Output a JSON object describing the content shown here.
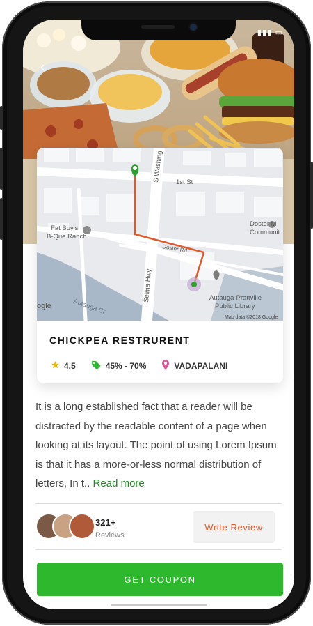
{
  "status": {
    "signal": "▮▮▮",
    "battery": "▭"
  },
  "map": {
    "street_washington": "S Washing",
    "street_1st": "1st St",
    "street_doster": "Doster Rd",
    "street_selma": "Selma Hwy",
    "street_autauga": "Autauga Cr",
    "poi_fatboys_1": "Fat Boy's",
    "poi_fatboys_2": "B-Que Ranch",
    "poi_doster_1": "Doster M",
    "poi_doster_2": "Communit",
    "poi_library_1": "Autauga-Prattville",
    "poi_library_2": "Public Library",
    "google_fragment": "ogle",
    "attribution": "Map data ©2018 Google"
  },
  "restaurant": {
    "name": "CHICKPEA RESTRURENT",
    "rating": "4.5",
    "discount": "45% - 70%",
    "location": "VADAPALANI"
  },
  "description": "It is a long established fact that a reader will be distracted by the readable content of a page when looking at its layout. The point of using Lorem Ipsum is that it has a more-or-less normal distribution of letters,  In t..",
  "read_more": "Read more",
  "reviews": {
    "count": "321+",
    "label": "Reviews",
    "write_label": "Write Review"
  },
  "coupon_label": "GET COUPON",
  "colors": {
    "accent_green": "#2eb82e",
    "link_green": "#1e8b1e",
    "write_orange": "#e05a2b",
    "route": "#e0572a",
    "pin_green": "#2ea12e"
  }
}
